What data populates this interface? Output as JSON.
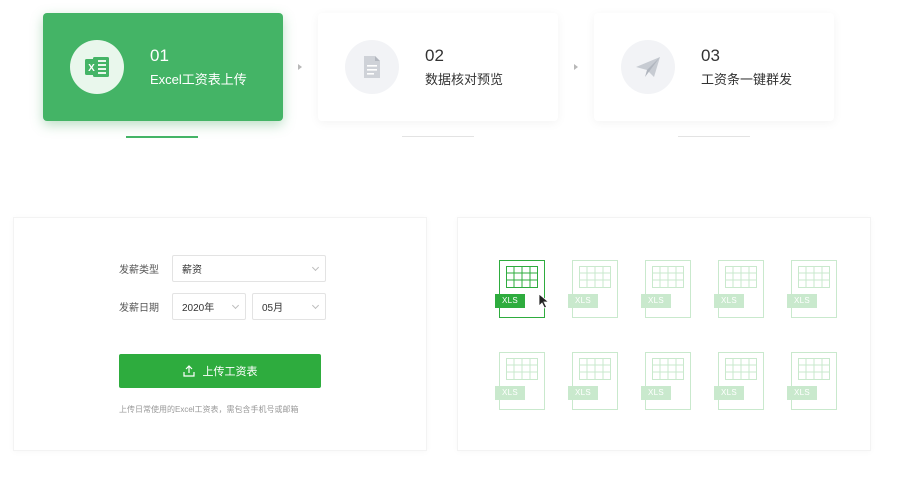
{
  "steps": [
    {
      "num": "01",
      "label": "Excel工资表上传",
      "icon": "excel-icon",
      "active": true
    },
    {
      "num": "02",
      "label": "数据核对预览",
      "icon": "document-icon",
      "active": false
    },
    {
      "num": "03",
      "label": "工资条一键群发",
      "icon": "send-plane-icon",
      "active": false
    }
  ],
  "form": {
    "pay_type_label": "发薪类型",
    "pay_type_value": "薪资",
    "pay_date_label": "发薪日期",
    "year_value": "2020年",
    "month_value": "05月"
  },
  "upload": {
    "button_label": "上传工资表",
    "hint": "上传日常使用的Excel工资表，需包含手机号或邮箱"
  },
  "files": {
    "badge": "XLS"
  },
  "colors": {
    "accent": "#44b466",
    "button": "#2eac3e"
  }
}
